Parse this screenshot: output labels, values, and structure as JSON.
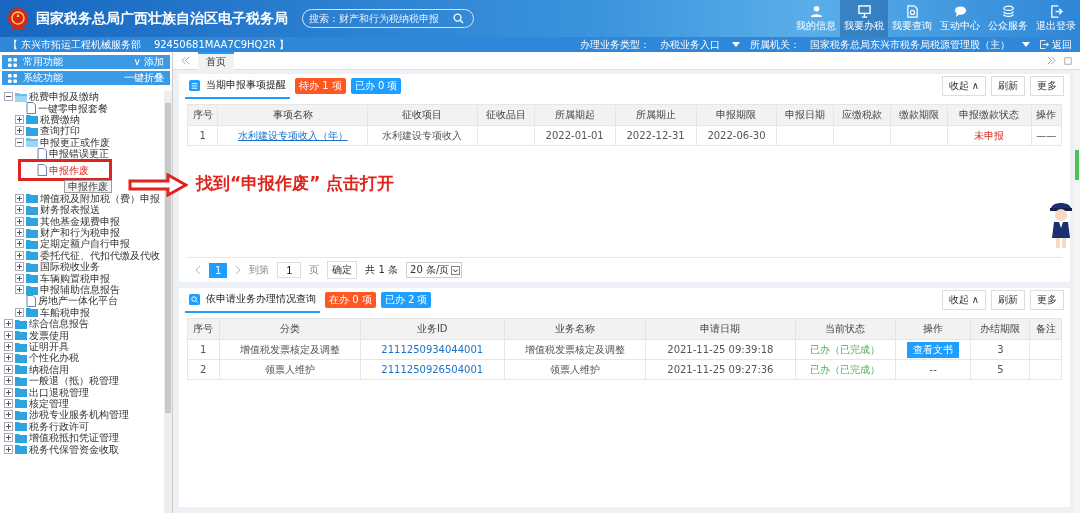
{
  "header": {
    "title": "国家税务总局广西壮族自治区电子税务局",
    "search": {
      "placeholder": "搜索：财产和行为税纳税申报"
    },
    "nav": [
      {
        "label": "我的信息",
        "kind": "user",
        "selected": false
      },
      {
        "label": "我要办税",
        "kind": "monitor",
        "selected": true
      },
      {
        "label": "我要查询",
        "kind": "query",
        "selected": false
      },
      {
        "label": "互动中心",
        "kind": "chat",
        "selected": false
      },
      {
        "label": "公众服务",
        "kind": "stack",
        "selected": false
      },
      {
        "label": "退出登录",
        "kind": "exit",
        "selected": false
      }
    ]
  },
  "info_bar": {
    "taxpayer": "【 东兴市拓运工程机械服务部    92450681MAA7C9HQ2R 】",
    "business_type_label": "办理业务类型：",
    "business_type": "办税业务入口",
    "authority_label": "所属机关：",
    "authority": "国家税务总局东兴市税务局税源管理股（主）",
    "back": "返回"
  },
  "sidebar": {
    "sections": [
      {
        "label": "常用功能",
        "action": "∨  添加"
      },
      {
        "label": "系统功能",
        "action": "一键折叠"
      }
    ],
    "tree": [
      {
        "label": "税费申报及缴纳",
        "kind": "folder",
        "expanded": true,
        "selected": false,
        "children": [
          {
            "label": "一键零申报套餐",
            "kind": "doc",
            "selected": false
          },
          {
            "label": "税费缴纳",
            "kind": "folder",
            "expanded": false,
            "selected": false
          },
          {
            "label": "查询打印",
            "kind": "folder",
            "expanded": false,
            "selected": false
          },
          {
            "label": "申报更正或作废",
            "kind": "folder",
            "expanded": true,
            "selected": false,
            "children": [
              {
                "label": "申报错误更正",
                "kind": "doc",
                "selected": false
              },
              {
                "label": "申报作废",
                "kind": "doc",
                "selected": true,
                "tooltip": "申报作废"
              }
            ]
          },
          {
            "label": "增值税及附加税（费）申报",
            "kind": "folder",
            "expanded": false,
            "selected": false
          },
          {
            "label": "财务报表报送",
            "kind": "folder",
            "expanded": false,
            "selected": false
          },
          {
            "label": "其他基金规费申报",
            "kind": "folder",
            "expanded": false,
            "selected": false
          },
          {
            "label": "财产和行为税申报",
            "kind": "folder",
            "expanded": false,
            "selected": false
          },
          {
            "label": "定期定额户自行申报",
            "kind": "folder",
            "expanded": false,
            "selected": false
          },
          {
            "label": "委托代征、代扣代缴及代收",
            "kind": "folder",
            "expanded": false,
            "selected": false
          },
          {
            "label": "国际税收业务",
            "kind": "folder",
            "expanded": false,
            "selected": false
          },
          {
            "label": "车辆购置税申报",
            "kind": "folder",
            "expanded": false,
            "selected": false
          },
          {
            "label": "申报辅助信息报告",
            "kind": "folder",
            "expanded": false,
            "selected": false
          },
          {
            "label": "房地产一体化平台",
            "kind": "doc",
            "selected": false
          },
          {
            "label": "车船税申报",
            "kind": "folder",
            "expanded": false,
            "selected": false
          }
        ]
      },
      {
        "label": "综合信息报告",
        "kind": "folder",
        "expanded": false,
        "selected": false
      },
      {
        "label": "发票使用",
        "kind": "folder",
        "expanded": false,
        "selected": false
      },
      {
        "label": "证明开具",
        "kind": "folder",
        "expanded": false,
        "selected": false
      },
      {
        "label": "个性化办税",
        "kind": "folder",
        "expanded": false,
        "selected": false
      },
      {
        "label": "纳税信用",
        "kind": "folder",
        "expanded": false,
        "selected": false
      },
      {
        "label": "一般退（抵）税管理",
        "kind": "folder",
        "expanded": false,
        "selected": false
      },
      {
        "label": "出口退税管理",
        "kind": "folder",
        "expanded": false,
        "selected": false
      },
      {
        "label": "核定管理",
        "kind": "folder",
        "expanded": false,
        "selected": false
      },
      {
        "label": "涉税专业服务机构管理",
        "kind": "folder",
        "expanded": false,
        "selected": false
      },
      {
        "label": "税务行政许可",
        "kind": "folder",
        "expanded": false,
        "selected": false
      },
      {
        "label": "增值税抵扣凭证管理",
        "kind": "folder",
        "expanded": false,
        "selected": false
      },
      {
        "label": "税务代保管资金收取",
        "kind": "folder",
        "expanded": false,
        "selected": false
      }
    ]
  },
  "tabs": [
    {
      "label": "首页",
      "selected": true
    }
  ],
  "panels": [
    {
      "title": "当期申报事项提醒",
      "badges": [
        {
          "label": "待办 1 项",
          "color": "#ff5722"
        },
        {
          "label": "已办 0 项",
          "color": "#1e9fff"
        }
      ],
      "buttons": [
        "收起 ∧",
        "刷新",
        "更多"
      ],
      "table": {
        "columns": [
          "序号",
          "事项名称",
          "征收项目",
          "征收品目",
          "所属期起",
          "所属期止",
          "申报期限",
          "申报日期",
          "应缴税款",
          "缴款期限",
          "申报缴款状态",
          "操作"
        ],
        "rows": [
          [
            {
              "text": "1",
              "kind": "plain"
            },
            {
              "text": "水利建设专项收入（年）",
              "kind": "link"
            },
            {
              "text": "水利建设专项收入",
              "kind": "plain"
            },
            {
              "kind": "empty"
            },
            {
              "text": "2022-01-01",
              "kind": "plain"
            },
            {
              "text": "2022-12-31",
              "kind": "plain"
            },
            {
              "text": "2022-06-30",
              "kind": "plain"
            },
            {
              "kind": "empty"
            },
            {
              "kind": "empty"
            },
            {
              "kind": "empty"
            },
            {
              "text": "未申报",
              "kind": "alert"
            },
            {
              "text": "——",
              "kind": "plain"
            }
          ]
        ]
      },
      "pagination": {
        "pages": [
          {
            "label": "1",
            "selected": true
          }
        ],
        "goto_label": "到第",
        "page_input": "1",
        "page_unit": "页",
        "confirm": "确定",
        "total": "共 1 条",
        "page_size": "20 条/页"
      }
    },
    {
      "title": "依申请业务办理情况查询",
      "badges": [
        {
          "label": "在办 0 项",
          "color": "#ff5722"
        },
        {
          "label": "已办 2 项",
          "color": "#1e9fff"
        }
      ],
      "buttons": [
        "收起 ∧",
        "刷新",
        "更多"
      ],
      "table": {
        "columns": [
          "序号",
          "分类",
          "业务ID",
          "业务名称",
          "申请日期",
          "当前状态",
          "操作",
          "办结期限",
          "备注"
        ],
        "rows": [
          [
            {
              "text": "1",
              "kind": "plain"
            },
            {
              "text": "增值税发票核定及调整",
              "kind": "plain"
            },
            {
              "text": "2111250934044001",
              "kind": "link"
            },
            {
              "text": "增值税发票核定及调整",
              "kind": "plain"
            },
            {
              "text": "2021-11-25 09:39:18",
              "kind": "plain"
            },
            {
              "text": "已办（已完成）",
              "kind": "done"
            },
            {
              "text": "查看文书",
              "kind": "button"
            },
            {
              "text": "3",
              "kind": "plain"
            },
            {
              "kind": "empty"
            }
          ],
          [
            {
              "text": "2",
              "kind": "plain"
            },
            {
              "text": "领票人维护",
              "kind": "plain"
            },
            {
              "text": "2111250926504001",
              "kind": "link"
            },
            {
              "text": "领票人维护",
              "kind": "plain"
            },
            {
              "text": "2021-11-25 09:27:36",
              "kind": "plain"
            },
            {
              "text": "已办（已完成）",
              "kind": "done"
            },
            {
              "text": "--",
              "kind": "plain"
            },
            {
              "text": "5",
              "kind": "plain"
            },
            {
              "kind": "empty"
            }
          ]
        ]
      }
    }
  ],
  "annotation": {
    "text": "找到“申报作废” 点击打开"
  }
}
